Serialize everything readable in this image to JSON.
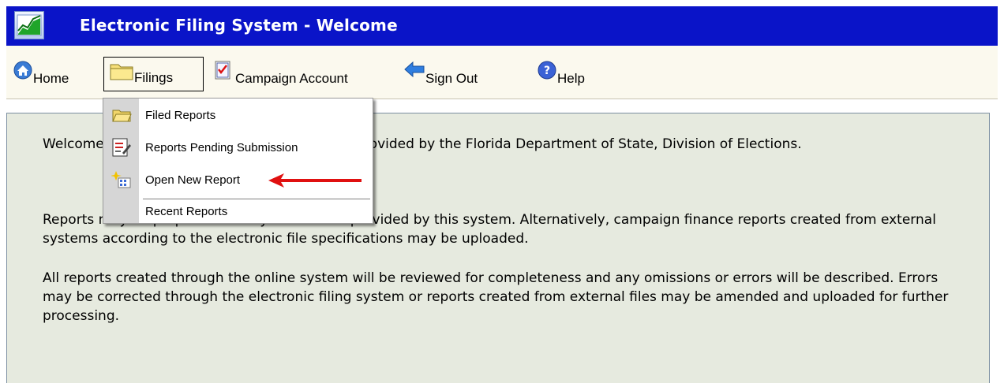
{
  "window": {
    "title": "Electronic Filing System - Welcome",
    "title_bar_color": "#0a14c8"
  },
  "nav": {
    "home": "Home",
    "filings": "Filings",
    "campaign_account": "Campaign Account",
    "sign_out": "Sign Out",
    "help": "Help"
  },
  "filings_menu": {
    "items": [
      {
        "label": "Filed Reports",
        "icon": "open-folder-icon"
      },
      {
        "label": "Reports Pending Submission",
        "icon": "edit-document-icon"
      },
      {
        "label": "Open New Report",
        "icon": "new-report-icon"
      },
      {
        "label": "Recent Reports",
        "icon": ""
      }
    ]
  },
  "content": {
    "paragraphs": [
      "Welcome to the Electronic Filing System (EFS) provided by the Florida Department of State, Division of Elections.",
      "Reports may be prepared directly from forms provided by this system. Alternatively, campaign finance reports created from external systems according to the electronic file specifications may be uploaded.",
      "All reports created through the online system will be reviewed for completeness and any omissions or errors will be described. Errors may be corrected through the electronic filing system or reports created from external files may be amended and uploaded for further processing."
    ]
  },
  "annotation": {
    "arrow_color": "#e01010",
    "points_to": "Open New Report"
  }
}
